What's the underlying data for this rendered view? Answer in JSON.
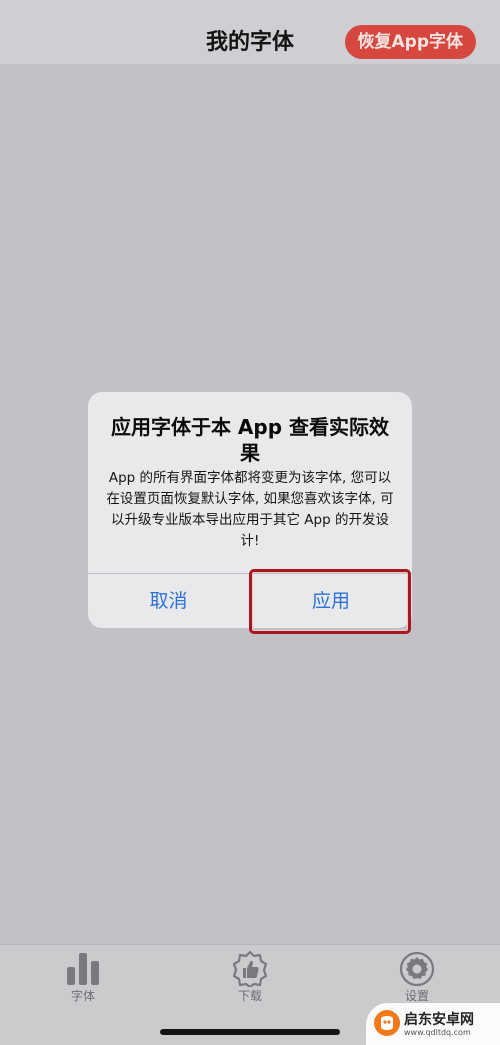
{
  "header": {
    "title": "我的字体",
    "restore_button": "恢复App字体"
  },
  "dialog": {
    "title": "应用字体于本 App 查看实际效果",
    "message": "App 的所有界面字体都将变更为该字体, 您可以在设置页面恢复默认字体, 如果您喜欢该字体, 可以升级专业版本导出应用于其它 App 的开发设计!",
    "cancel_label": "取消",
    "apply_label": "应用"
  },
  "tabbar": {
    "items": [
      {
        "label": "字体",
        "icon": "bar-chart-icon"
      },
      {
        "label": "下载",
        "icon": "thumbs-up-badge-icon"
      },
      {
        "label": "设置",
        "icon": "gear-icon"
      }
    ]
  },
  "watermark": {
    "text": "启东安卓网",
    "url": "www.qdltdq.com"
  },
  "colors": {
    "accent_red": "#d5473f",
    "dialog_button_blue": "#2c73d8",
    "highlight_red": "#a8161f"
  }
}
